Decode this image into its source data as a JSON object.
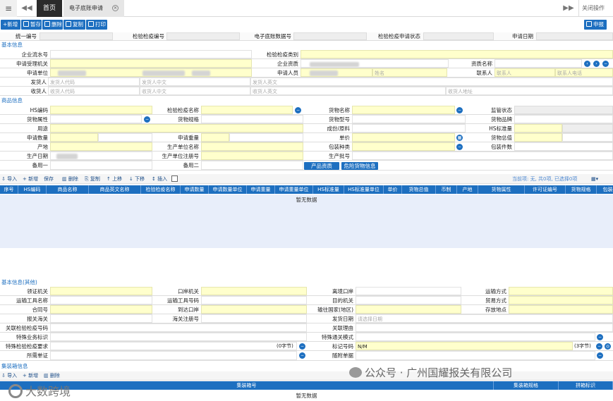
{
  "topbar": {
    "menu_icon": "≡",
    "back_icon": "◀◀",
    "home_tab": "首页",
    "active_tab": "电子底账申请",
    "fwd_icon": "▶▶",
    "close_ops": "关闭操作"
  },
  "toolbar": {
    "new": "新增",
    "save": "暂存",
    "delete": "删除",
    "copy": "复制",
    "print": "打印",
    "declare": "申报"
  },
  "header_row": {
    "unified_no": "统一编号",
    "inspection_no": "检验检疫编号",
    "e_bill_no": "电子底账数据号",
    "status": "检验检疫申请状态",
    "apply_date": "申请日期"
  },
  "basic_info": {
    "title": "基本信息",
    "enterprise_seq": "企业流水号",
    "inspection_category": "检验检疫类别",
    "accept_org": "申请受理机关",
    "enterprise_qual": "企业资质",
    "qual_name": "资质名称",
    "apply_unit": "申请单位",
    "applicant": "申请人员",
    "name_ph": "姓名",
    "contact": "联系人",
    "contact_ph": "联系人",
    "contact_tel_ph": "联系人电话",
    "shipper": "发货人",
    "shipper_code_ph": "发货人代码",
    "shipper_cn_ph": "发货人中文",
    "shipper_en_ph": "发货人英文",
    "consignee": "收货人",
    "consignee_code_ph": "收货人代码",
    "consignee_cn_ph": "收货人中文",
    "consignee_en_ph": "收货人英文",
    "consignee_addr_ph": "收货人地址"
  },
  "goods_info": {
    "title": "商品信息",
    "hs_code": "HS编码",
    "inspection_name": "检验检疫名称",
    "goods_name": "货物名称",
    "supervision_status": "监管状态",
    "goods_attr": "货物属性",
    "goods_spec": "货物规格",
    "goods_model": "货物型号",
    "goods_brand": "货物品牌",
    "usage": "用途",
    "composition": "成份/原料",
    "hs_std_qty": "HS标准量",
    "apply_qty": "申请数量",
    "apply_weight": "申请重量",
    "unit_price": "单价",
    "goods_total": "货物总值",
    "origin": "产地",
    "producer_name": "生产单位名称",
    "package_type": "包装种类",
    "package_count": "包装件数",
    "prod_date": "生产日期",
    "producer_reg": "生产单位注册号",
    "prod_batch": "生产批号",
    "remark1": "备用一",
    "remark2": "备用二",
    "product_qual_btn": "产品资质",
    "dangerous_btn": "危险货物信息"
  },
  "goods_grid": {
    "import": "导入",
    "new": "新增",
    "save": "保存",
    "delete": "删除",
    "copy": "复制",
    "up": "上移",
    "down": "下移",
    "insert": "插入",
    "summary": "当前项: 无, 共0项, 已选择0项",
    "columns": [
      "序号",
      "HS编码",
      "商品名称",
      "商品英文名称",
      "检验检疫名称",
      "申请数量",
      "申请数量单位",
      "申请重量",
      "申请重量单位",
      "HS标准量",
      "HS标准量单位",
      "单价",
      "货物总值",
      "币制",
      "产地",
      "货物属性",
      "许可证编号",
      "货物规格",
      "包装件数"
    ],
    "no_data": "暂无数据"
  },
  "other_info": {
    "title": "基本信息(其他)",
    "cert_org": "领证机关",
    "port_org": "口岸机关",
    "depart_port": "离境口岸",
    "transport_mode": "运输方式",
    "vehicle_name": "运输工具名称",
    "vehicle_no": "运输工具号码",
    "dest_org": "目的机关",
    "trade_mode": "贸易方式",
    "contract_no": "合同号",
    "arrival_port": "到达口岸",
    "dest_country": "输往国家(地区)",
    "storage": "存放地点",
    "customs": "报关海关",
    "customs_reg": "海关注册号",
    "ship_date": "发货日期",
    "ship_date_ph": "请选择日期",
    "related_no": "关联检验检疫号码",
    "related_reason": "关联理由",
    "special_biz": "特殊业务标识",
    "special_clearance": "特殊通关模式",
    "special_req": "特殊检验检疫要求",
    "byte0a": "(0字节)",
    "mark_no": "标记号码",
    "mark_val": "N/M",
    "byte3": "(3字节)",
    "docs": "所需单证",
    "attached": "随附单据"
  },
  "container": {
    "title": "集装箱信息",
    "import": "导入",
    "new": "新增",
    "delete": "删除",
    "columns": [
      "集装箱号",
      "集装箱规格",
      "拼箱标识"
    ],
    "no_data": "暂无数据"
  },
  "watermark": {
    "wechat": "公众号 · 广州国耀报关有限公司",
    "brand": "大数跨境"
  },
  "colors": {
    "accent": "#1d6fc0",
    "input_yellow": "#ffffcc",
    "grid_body": "#e8eefa"
  }
}
